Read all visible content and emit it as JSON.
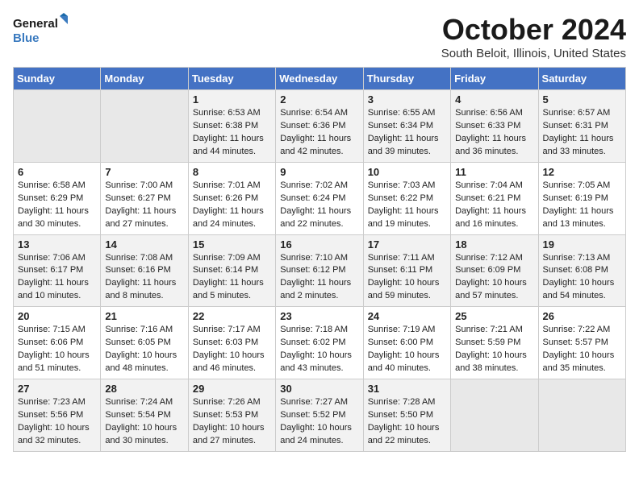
{
  "header": {
    "logo_line1": "General",
    "logo_line2": "Blue",
    "month": "October 2024",
    "location": "South Beloit, Illinois, United States"
  },
  "days_of_week": [
    "Sunday",
    "Monday",
    "Tuesday",
    "Wednesday",
    "Thursday",
    "Friday",
    "Saturday"
  ],
  "weeks": [
    [
      {
        "day": "",
        "info": ""
      },
      {
        "day": "",
        "info": ""
      },
      {
        "day": "1",
        "info": "Sunrise: 6:53 AM\nSunset: 6:38 PM\nDaylight: 11 hours and 44 minutes."
      },
      {
        "day": "2",
        "info": "Sunrise: 6:54 AM\nSunset: 6:36 PM\nDaylight: 11 hours and 42 minutes."
      },
      {
        "day": "3",
        "info": "Sunrise: 6:55 AM\nSunset: 6:34 PM\nDaylight: 11 hours and 39 minutes."
      },
      {
        "day": "4",
        "info": "Sunrise: 6:56 AM\nSunset: 6:33 PM\nDaylight: 11 hours and 36 minutes."
      },
      {
        "day": "5",
        "info": "Sunrise: 6:57 AM\nSunset: 6:31 PM\nDaylight: 11 hours and 33 minutes."
      }
    ],
    [
      {
        "day": "6",
        "info": "Sunrise: 6:58 AM\nSunset: 6:29 PM\nDaylight: 11 hours and 30 minutes."
      },
      {
        "day": "7",
        "info": "Sunrise: 7:00 AM\nSunset: 6:27 PM\nDaylight: 11 hours and 27 minutes."
      },
      {
        "day": "8",
        "info": "Sunrise: 7:01 AM\nSunset: 6:26 PM\nDaylight: 11 hours and 24 minutes."
      },
      {
        "day": "9",
        "info": "Sunrise: 7:02 AM\nSunset: 6:24 PM\nDaylight: 11 hours and 22 minutes."
      },
      {
        "day": "10",
        "info": "Sunrise: 7:03 AM\nSunset: 6:22 PM\nDaylight: 11 hours and 19 minutes."
      },
      {
        "day": "11",
        "info": "Sunrise: 7:04 AM\nSunset: 6:21 PM\nDaylight: 11 hours and 16 minutes."
      },
      {
        "day": "12",
        "info": "Sunrise: 7:05 AM\nSunset: 6:19 PM\nDaylight: 11 hours and 13 minutes."
      }
    ],
    [
      {
        "day": "13",
        "info": "Sunrise: 7:06 AM\nSunset: 6:17 PM\nDaylight: 11 hours and 10 minutes."
      },
      {
        "day": "14",
        "info": "Sunrise: 7:08 AM\nSunset: 6:16 PM\nDaylight: 11 hours and 8 minutes."
      },
      {
        "day": "15",
        "info": "Sunrise: 7:09 AM\nSunset: 6:14 PM\nDaylight: 11 hours and 5 minutes."
      },
      {
        "day": "16",
        "info": "Sunrise: 7:10 AM\nSunset: 6:12 PM\nDaylight: 11 hours and 2 minutes."
      },
      {
        "day": "17",
        "info": "Sunrise: 7:11 AM\nSunset: 6:11 PM\nDaylight: 10 hours and 59 minutes."
      },
      {
        "day": "18",
        "info": "Sunrise: 7:12 AM\nSunset: 6:09 PM\nDaylight: 10 hours and 57 minutes."
      },
      {
        "day": "19",
        "info": "Sunrise: 7:13 AM\nSunset: 6:08 PM\nDaylight: 10 hours and 54 minutes."
      }
    ],
    [
      {
        "day": "20",
        "info": "Sunrise: 7:15 AM\nSunset: 6:06 PM\nDaylight: 10 hours and 51 minutes."
      },
      {
        "day": "21",
        "info": "Sunrise: 7:16 AM\nSunset: 6:05 PM\nDaylight: 10 hours and 48 minutes."
      },
      {
        "day": "22",
        "info": "Sunrise: 7:17 AM\nSunset: 6:03 PM\nDaylight: 10 hours and 46 minutes."
      },
      {
        "day": "23",
        "info": "Sunrise: 7:18 AM\nSunset: 6:02 PM\nDaylight: 10 hours and 43 minutes."
      },
      {
        "day": "24",
        "info": "Sunrise: 7:19 AM\nSunset: 6:00 PM\nDaylight: 10 hours and 40 minutes."
      },
      {
        "day": "25",
        "info": "Sunrise: 7:21 AM\nSunset: 5:59 PM\nDaylight: 10 hours and 38 minutes."
      },
      {
        "day": "26",
        "info": "Sunrise: 7:22 AM\nSunset: 5:57 PM\nDaylight: 10 hours and 35 minutes."
      }
    ],
    [
      {
        "day": "27",
        "info": "Sunrise: 7:23 AM\nSunset: 5:56 PM\nDaylight: 10 hours and 32 minutes."
      },
      {
        "day": "28",
        "info": "Sunrise: 7:24 AM\nSunset: 5:54 PM\nDaylight: 10 hours and 30 minutes."
      },
      {
        "day": "29",
        "info": "Sunrise: 7:26 AM\nSunset: 5:53 PM\nDaylight: 10 hours and 27 minutes."
      },
      {
        "day": "30",
        "info": "Sunrise: 7:27 AM\nSunset: 5:52 PM\nDaylight: 10 hours and 24 minutes."
      },
      {
        "day": "31",
        "info": "Sunrise: 7:28 AM\nSunset: 5:50 PM\nDaylight: 10 hours and 22 minutes."
      },
      {
        "day": "",
        "info": ""
      },
      {
        "day": "",
        "info": ""
      }
    ]
  ]
}
